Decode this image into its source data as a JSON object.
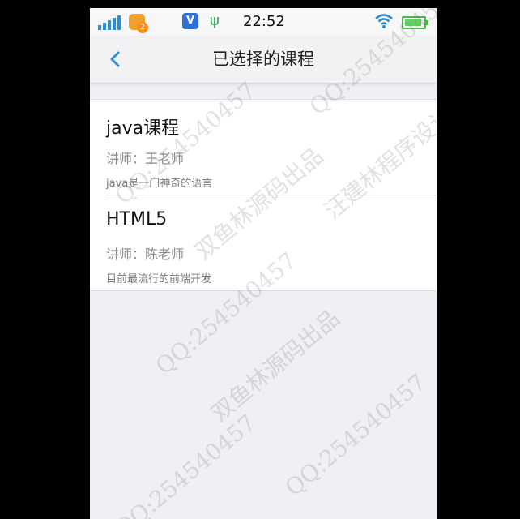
{
  "status_bar": {
    "time": "22:52",
    "notification_count": "2",
    "app_icon_letter": "V",
    "usb_glyph": "ψ"
  },
  "nav": {
    "title": "已选择的课程",
    "back_icon": "chevron-left-icon"
  },
  "courses": [
    {
      "name": "java课程",
      "teacher": "讲师：王老师",
      "description": "java是一门神奇的语言"
    },
    {
      "name": "HTML5",
      "teacher": "讲师：陈老师",
      "description": "目前最流行的前端开发"
    }
  ],
  "watermarks": {
    "qq": "QQ:254540457",
    "brand1": "汪建林程序设计",
    "brand2": "双鱼林源码出品"
  },
  "colors": {
    "accent": "#2b8fd8",
    "nav_bg": "#f2f2f4",
    "page_bg": "#efeff4"
  }
}
